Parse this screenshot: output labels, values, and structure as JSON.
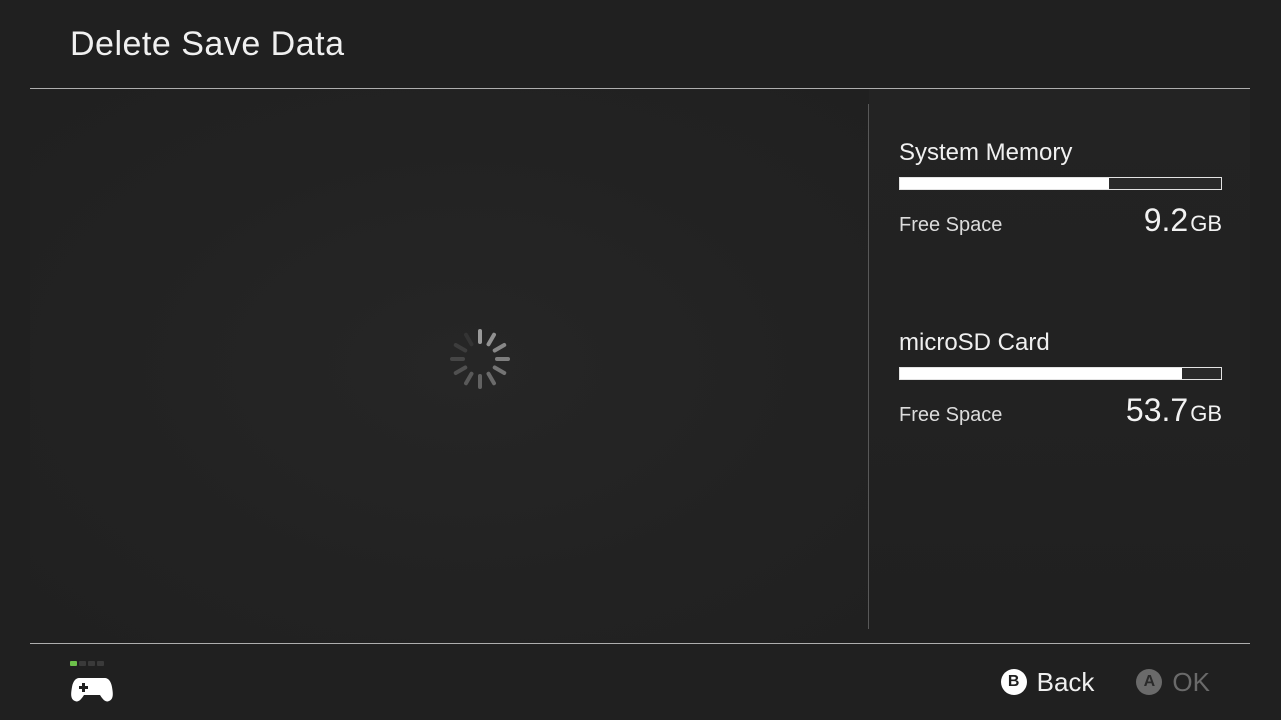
{
  "header": {
    "title": "Delete Save Data"
  },
  "storage": [
    {
      "title": "System Memory",
      "fill_percent": 65,
      "free_label": "Free Space",
      "free_value": "9.2",
      "free_unit": "GB"
    },
    {
      "title": "microSD Card",
      "fill_percent": 88,
      "free_label": "Free Space",
      "free_value": "53.7",
      "free_unit": "GB"
    }
  ],
  "footer": {
    "controller_battery_level": 1,
    "hints": {
      "back": {
        "button": "B",
        "label": "Back"
      },
      "ok": {
        "button": "A",
        "label": "OK"
      }
    }
  }
}
